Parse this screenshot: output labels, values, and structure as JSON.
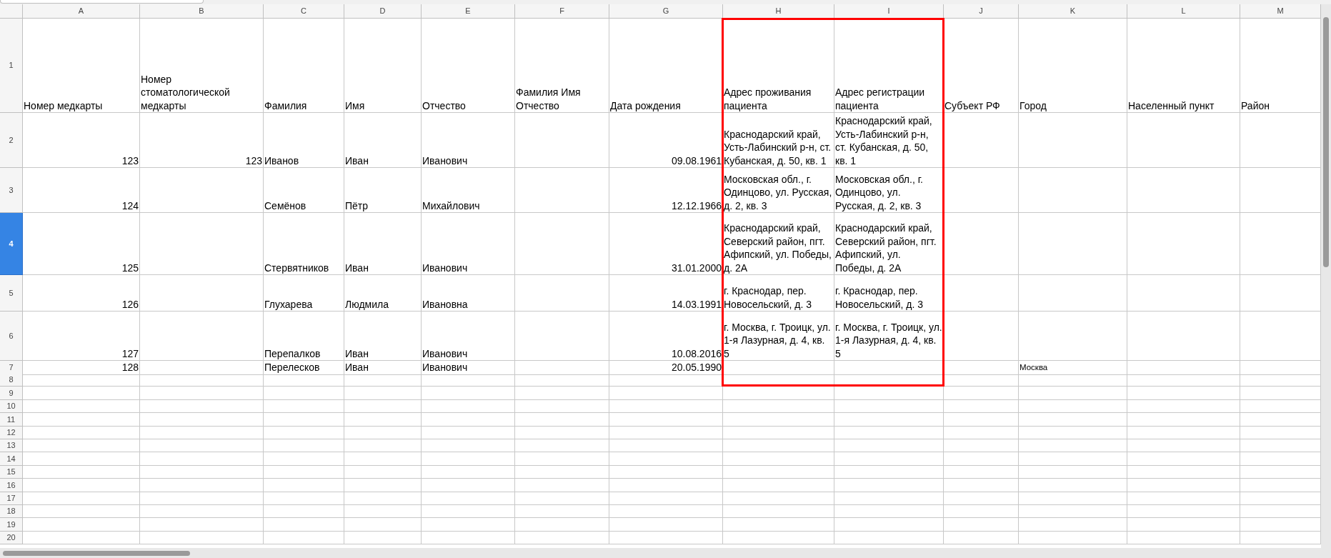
{
  "columns": [
    "A",
    "B",
    "C",
    "D",
    "E",
    "F",
    "G",
    "H",
    "I",
    "J",
    "K",
    "L",
    "M"
  ],
  "rows": [
    {
      "number": "1",
      "selected": false,
      "cells": {
        "A": {
          "kind": "text",
          "text": "Номер медкарты"
        },
        "B": {
          "kind": "text",
          "text": "Номер стоматологической медкарты"
        },
        "C": {
          "kind": "text",
          "text": "Фамилия"
        },
        "D": {
          "kind": "text",
          "text": "Имя"
        },
        "E": {
          "kind": "text",
          "text": "Отчество"
        },
        "F": {
          "kind": "text",
          "text": "Фамилия Имя Отчество"
        },
        "G": {
          "kind": "text",
          "text": "Дата рождения"
        },
        "H": {
          "kind": "text",
          "text": "Адрес проживания пациента"
        },
        "I": {
          "kind": "text",
          "text": "Адрес регистрации пациента"
        },
        "J": {
          "kind": "text",
          "text": "Субъект РФ"
        },
        "K": {
          "kind": "text",
          "text": "Город"
        },
        "L": {
          "kind": "text",
          "text": "Населенный пункт"
        },
        "M": {
          "kind": "text",
          "text": "Район"
        }
      }
    },
    {
      "number": "2",
      "selected": false,
      "cells": {
        "A": {
          "kind": "number",
          "text": "123"
        },
        "B": {
          "kind": "number",
          "text": "123"
        },
        "C": {
          "kind": "text",
          "text": "Иванов"
        },
        "D": {
          "kind": "text",
          "text": "Иван"
        },
        "E": {
          "kind": "text",
          "text": "Иванович"
        },
        "G": {
          "kind": "number",
          "text": "09.08.1961"
        },
        "H": {
          "kind": "text",
          "text": "Краснодарский край, Усть-Лабинский р-н, ст. Кубанская, д. 50, кв. 1"
        },
        "I": {
          "kind": "text",
          "text": "Краснодарский край, Усть-Лабинский р-н, ст. Кубанская, д. 50, кв. 1"
        }
      }
    },
    {
      "number": "3",
      "selected": false,
      "cells": {
        "A": {
          "kind": "number",
          "text": "124"
        },
        "C": {
          "kind": "text",
          "text": "Семёнов"
        },
        "D": {
          "kind": "text",
          "text": "Пётр"
        },
        "E": {
          "kind": "text",
          "text": "Михайлович"
        },
        "G": {
          "kind": "number",
          "text": "12.12.1966"
        },
        "H": {
          "kind": "text",
          "text": "Московская обл., г. Одинцово, ул. Русская, д. 2, кв. 3"
        },
        "I": {
          "kind": "text",
          "text": "Московская обл., г. Одинцово, ул. Русская, д. 2, кв. 3"
        }
      }
    },
    {
      "number": "4",
      "selected": true,
      "cells": {
        "A": {
          "kind": "number",
          "text": "125"
        },
        "C": {
          "kind": "text",
          "text": "Стервятников"
        },
        "D": {
          "kind": "text",
          "text": "Иван"
        },
        "E": {
          "kind": "text",
          "text": "Иванович"
        },
        "G": {
          "kind": "number",
          "text": "31.01.2000"
        },
        "H": {
          "kind": "text",
          "text": "Краснодарский край, Северский район, пгт. Афипский, ул. Победы, д. 2А"
        },
        "I": {
          "kind": "text",
          "text": "Краснодарский край, Северский район, пгт. Афипский, ул. Победы, д. 2А"
        }
      }
    },
    {
      "number": "5",
      "selected": false,
      "cells": {
        "A": {
          "kind": "number",
          "text": "126"
        },
        "C": {
          "kind": "text",
          "text": "Глухарева"
        },
        "D": {
          "kind": "text",
          "text": "Людмила"
        },
        "E": {
          "kind": "text",
          "text": "Ивановна"
        },
        "G": {
          "kind": "number",
          "text": "14.03.1991"
        },
        "H": {
          "kind": "text",
          "text": "г. Краснодар, пер. Новосельский, д. 3"
        },
        "I": {
          "kind": "text",
          "text": "г. Краснодар, пер. Новосельский, д. 3"
        }
      }
    },
    {
      "number": "6",
      "selected": false,
      "cells": {
        "A": {
          "kind": "number",
          "text": "127"
        },
        "C": {
          "kind": "text",
          "text": "Перепалков"
        },
        "D": {
          "kind": "text",
          "text": "Иван"
        },
        "E": {
          "kind": "text",
          "text": "Иванович"
        },
        "G": {
          "kind": "number",
          "text": "10.08.2016"
        },
        "H": {
          "kind": "text",
          "text": "г. Москва, г. Троицк, ул. 1-я Лазурная, д. 4, кв. 5"
        },
        "I": {
          "kind": "text",
          "text": "г. Москва, г. Троицк, ул. 1-я Лазурная, д. 4, кв. 5"
        }
      }
    },
    {
      "number": "7",
      "selected": false,
      "cells": {
        "A": {
          "kind": "number",
          "text": "128"
        },
        "C": {
          "kind": "text",
          "text": "Перелесков"
        },
        "D": {
          "kind": "text",
          "text": "Иван"
        },
        "E": {
          "kind": "text",
          "text": "Иванович"
        },
        "G": {
          "kind": "number",
          "text": "20.05.1990"
        },
        "K": {
          "kind": "small",
          "text": "Москва"
        }
      }
    },
    {
      "number": "8",
      "selected": false
    },
    {
      "number": "9",
      "selected": false
    },
    {
      "number": "10",
      "selected": false
    },
    {
      "number": "11",
      "selected": false
    },
    {
      "number": "12",
      "selected": false
    },
    {
      "number": "13",
      "selected": false
    },
    {
      "number": "14",
      "selected": false
    },
    {
      "number": "15",
      "selected": false
    },
    {
      "number": "16",
      "selected": false
    },
    {
      "number": "17",
      "selected": false
    },
    {
      "number": "18",
      "selected": false
    },
    {
      "number": "19",
      "selected": false
    },
    {
      "number": "20",
      "selected": false
    }
  ]
}
